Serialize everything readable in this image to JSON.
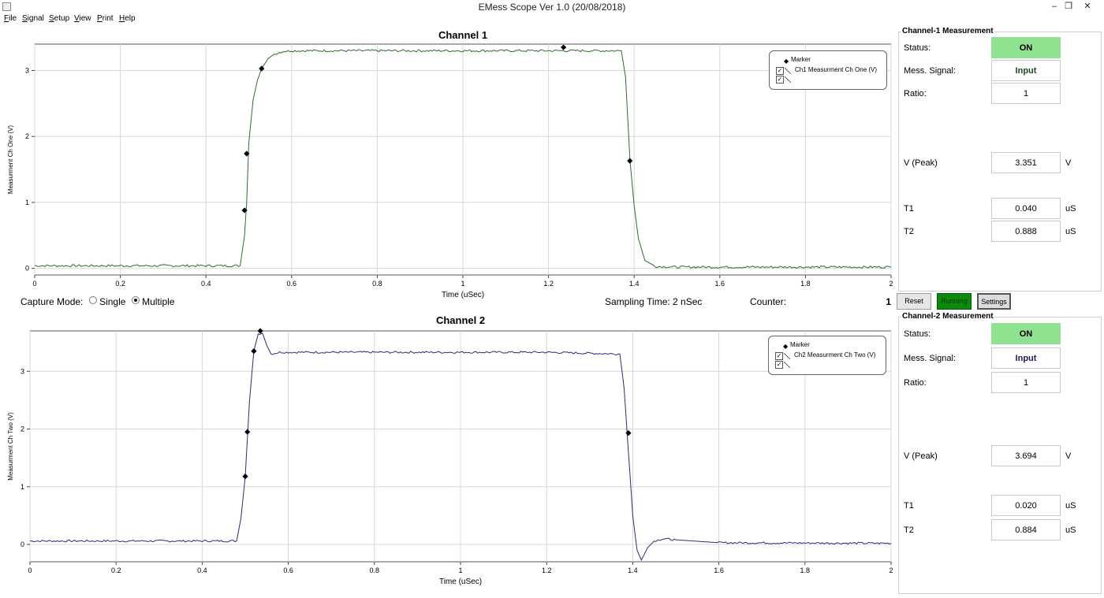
{
  "window": {
    "title": "EMess Scope Ver 1.0 (20/08/2018)",
    "min_icon": "minimize-icon",
    "max_icon": "restore-icon",
    "close_icon": "close-icon"
  },
  "menu": [
    {
      "label": "File"
    },
    {
      "label": "Signal"
    },
    {
      "label": "Setup"
    },
    {
      "label": "View"
    },
    {
      "label": "Print"
    },
    {
      "label": "Help"
    }
  ],
  "channel1": {
    "title": "Channel 1",
    "legend": {
      "marker": "Marker",
      "series": "Ch1 Measurment Ch One (V)"
    },
    "chart_data": {
      "type": "line",
      "title": "Channel 1",
      "xlabel": "Time (uSec)",
      "ylabel": "Measurment Ch One (V)",
      "xlim": [
        0,
        2
      ],
      "ylim": [
        -0.1,
        3.4
      ],
      "xticks": [
        "0",
        "0.2",
        "0.4",
        "0.6",
        "0.8",
        "1",
        "1.2",
        "1.4",
        "1.6",
        "1.8",
        "2"
      ],
      "yticks": [
        "0",
        "1",
        "2",
        "3"
      ],
      "grid": true,
      "legend_position": "top-right",
      "color": "#2f6b2f",
      "series": [
        {
          "name": "Ch1 Measurment Ch One (V)",
          "x": [
            0,
            0.48,
            0.49,
            0.495,
            0.5,
            0.51,
            0.52,
            0.53,
            0.545,
            0.56,
            0.58,
            0.6,
            0.8,
            1.0,
            1.2,
            1.37,
            1.38,
            1.39,
            1.4,
            1.41,
            1.425,
            1.45,
            1.5,
            2.0
          ],
          "y": [
            0.04,
            0.04,
            0.5,
            1.0,
            1.9,
            2.55,
            2.85,
            3.03,
            3.18,
            3.25,
            3.29,
            3.3,
            3.3,
            3.3,
            3.3,
            3.3,
            2.9,
            1.65,
            0.95,
            0.45,
            0.12,
            0.03,
            0.02,
            0.02
          ]
        },
        {
          "name": "Marker",
          "x": [
            0.49,
            0.495,
            0.53,
            1.235,
            1.39
          ],
          "y": [
            0.88,
            1.74,
            3.03,
            3.35,
            1.63
          ]
        }
      ]
    }
  },
  "channel2": {
    "title": "Channel 2",
    "legend": {
      "marker": "Marker",
      "series": "Ch2 Measurment Ch Two (V)"
    },
    "chart_data": {
      "type": "line",
      "title": "Channel 2",
      "xlabel": "Time (uSec)",
      "ylabel": "Measurment Ch Two (V)",
      "xlim": [
        0,
        2
      ],
      "ylim": [
        -0.3,
        3.7
      ],
      "xticks": [
        "0",
        "0.2",
        "0.4",
        "0.6",
        "0.8",
        "1",
        "1.2",
        "1.4",
        "1.6",
        "1.8",
        "2"
      ],
      "yticks": [
        "0",
        "1",
        "2",
        "3"
      ],
      "grid": true,
      "legend_position": "top-right",
      "color": "#2b2b7a",
      "series": [
        {
          "name": "Ch2 Measurment Ch Two (V)",
          "x": [
            0,
            0.48,
            0.49,
            0.5,
            0.51,
            0.52,
            0.53,
            0.54,
            0.55,
            0.56,
            0.58,
            0.6,
            0.8,
            1.0,
            1.2,
            1.37,
            1.38,
            1.39,
            1.4,
            1.41,
            1.42,
            1.435,
            1.45,
            1.47,
            1.5,
            1.6,
            2.0
          ],
          "y": [
            0.06,
            0.06,
            0.45,
            1.18,
            2.5,
            3.35,
            3.65,
            3.66,
            3.45,
            3.3,
            3.33,
            3.33,
            3.33,
            3.33,
            3.33,
            3.3,
            2.7,
            1.6,
            0.5,
            -0.1,
            -0.27,
            -0.05,
            0.06,
            0.1,
            0.08,
            0.03,
            0.02
          ]
        },
        {
          "name": "Marker",
          "x": [
            0.5,
            0.505,
            0.52,
            0.535,
            1.39
          ],
          "y": [
            1.18,
            1.95,
            3.35,
            3.7,
            1.93
          ]
        }
      ]
    }
  },
  "controls": {
    "capture_label": "Capture Mode:",
    "single_label": "Single",
    "multiple_label": "Multiple",
    "capture_mode": "Multiple",
    "sampling": "Sampling Time: 2 nSec",
    "counter_label": "Counter:",
    "counter_value": "1",
    "reset": "Reset",
    "running": "Running",
    "settings": "Settings",
    "running_color": "#0c8a0c"
  },
  "meas1": {
    "title": "Channel-1 Measurement",
    "status_label": "Status:",
    "status": "ON",
    "status_color": "#8fe28f",
    "signal_label": "Mess. Signal:",
    "signal": "Input",
    "ratio_label": "Ratio:",
    "ratio": "1",
    "vpeak_label": "V (Peak)",
    "vpeak": "3.351",
    "vpeak_unit": "V",
    "t1_label": "T1",
    "t1": "0.040",
    "t1_unit": "uS",
    "t2_label": "T2",
    "t2": "0.888",
    "t2_unit": "uS"
  },
  "meas2": {
    "title": "Channel-2 Measurement",
    "status_label": "Status:",
    "status": "ON",
    "status_color": "#8fe28f",
    "signal_label": "Mess. Signal:",
    "signal": "Input",
    "ratio_label": "Ratio:",
    "ratio": "1",
    "vpeak_label": "V (Peak)",
    "vpeak": "3.694",
    "vpeak_unit": "V",
    "t1_label": "T1",
    "t1": "0.020",
    "t1_unit": "uS",
    "t2_label": "T2",
    "t2": "0.884",
    "t2_unit": "uS"
  }
}
